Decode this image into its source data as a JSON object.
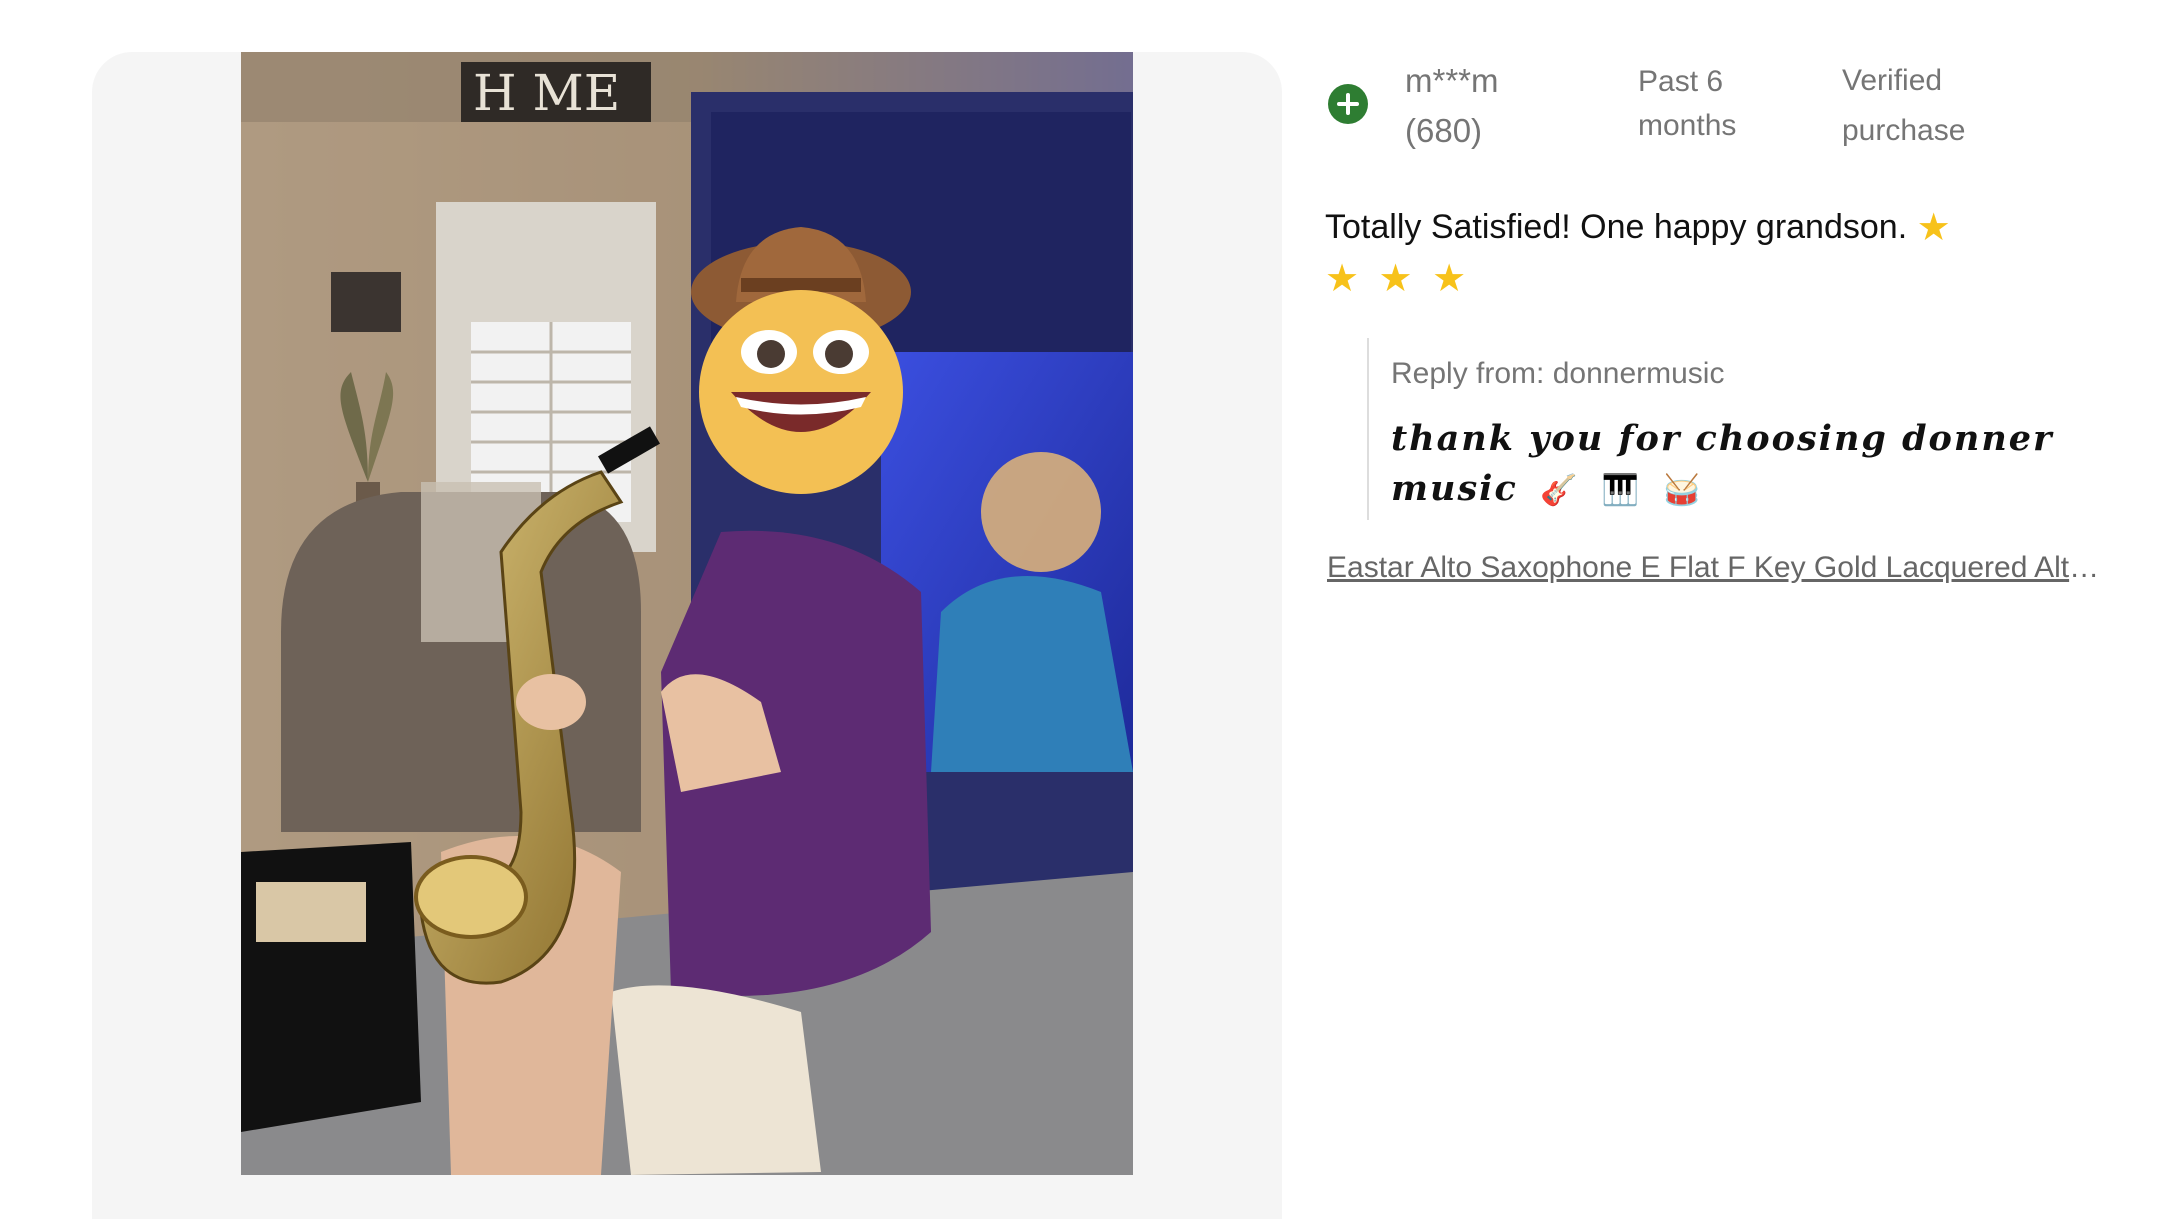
{
  "review": {
    "reviewer_name": "m***m",
    "reviewer_count": "(680)",
    "date_line1": "Past 6",
    "date_line2": "months",
    "verified_line1": "Verified",
    "verified_line2": "purchase",
    "text": "Totally Satisfied! One happy grandson.",
    "star_glyph": "★",
    "star_color": "#f7c21a"
  },
  "reply": {
    "label": "Reply from: donnermusic",
    "message": "thank you for choosing donner music",
    "emoji_guitar": "🎸",
    "emoji_piano": "🎹",
    "emoji_drum": "🥁"
  },
  "product": {
    "link_text": "Eastar Alto Saxophone E Flat F Key Gold Lacquered Alto Saxophone"
  },
  "photo": {
    "wall_sign_text": "H  ME",
    "face_overlay": "cowboy-emoji"
  },
  "colors": {
    "accent_green": "#2e7d32",
    "link_gray": "#666666"
  }
}
